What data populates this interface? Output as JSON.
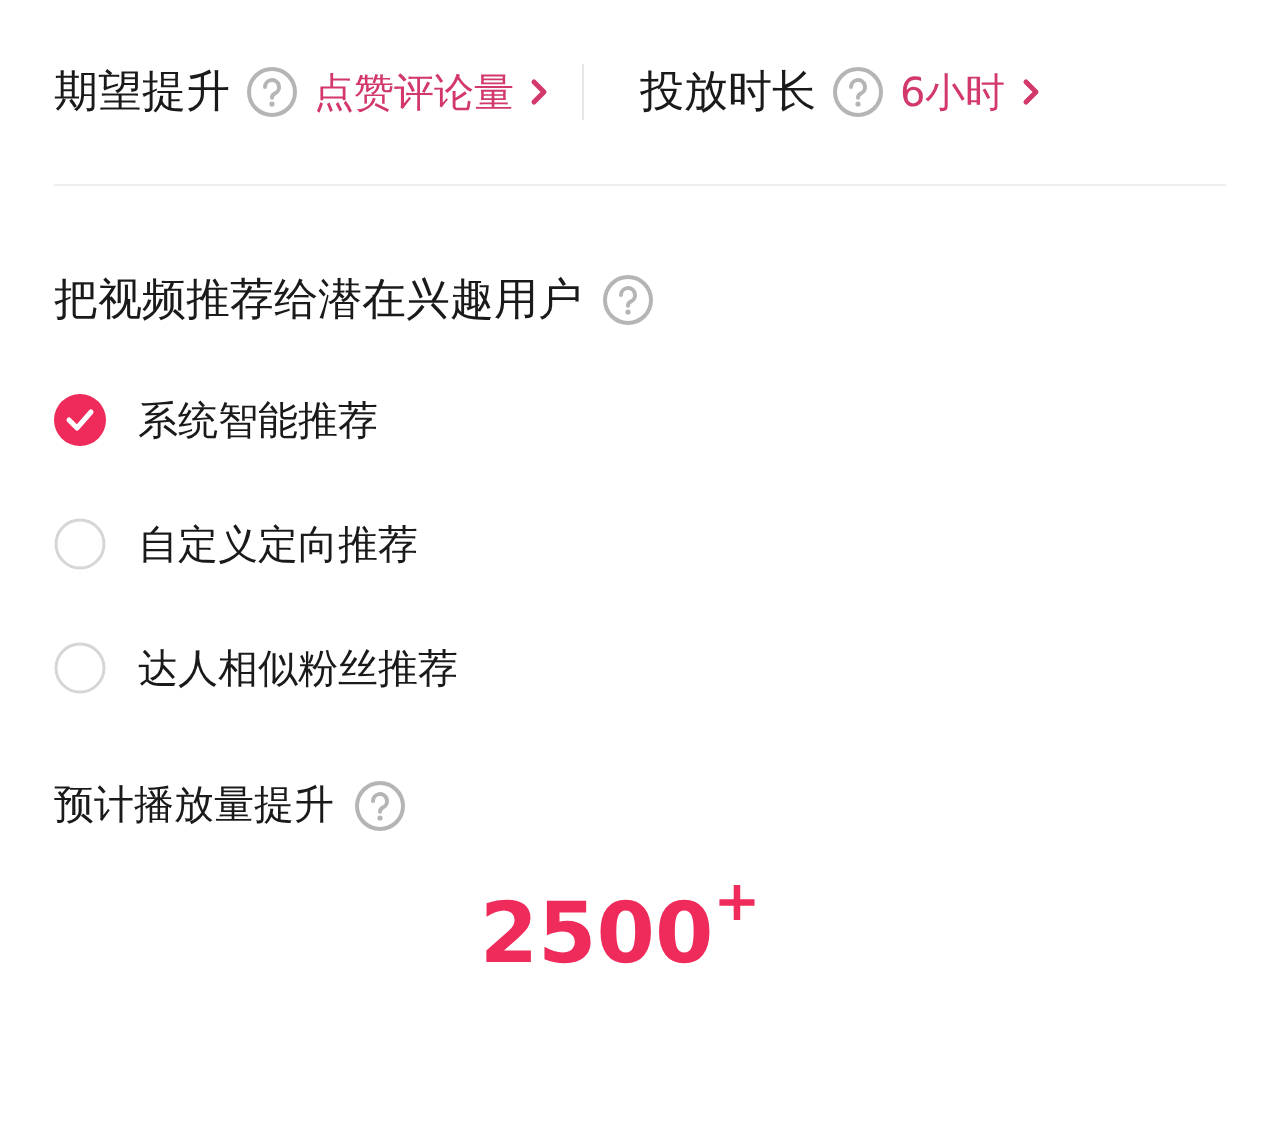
{
  "settings": [
    {
      "label": "期望提升",
      "value": "点赞评论量"
    },
    {
      "label": "投放时长",
      "value": "6小时"
    }
  ],
  "audience": {
    "title": "把视频推荐给潜在兴趣用户",
    "options": [
      {
        "label": "系统智能推荐",
        "selected": true
      },
      {
        "label": "自定义定向推荐",
        "selected": false
      },
      {
        "label": "达人相似粉丝推荐",
        "selected": false
      }
    ]
  },
  "estimate": {
    "label": "预计播放量提升",
    "value": "2500$^{+}$"
  }
}
